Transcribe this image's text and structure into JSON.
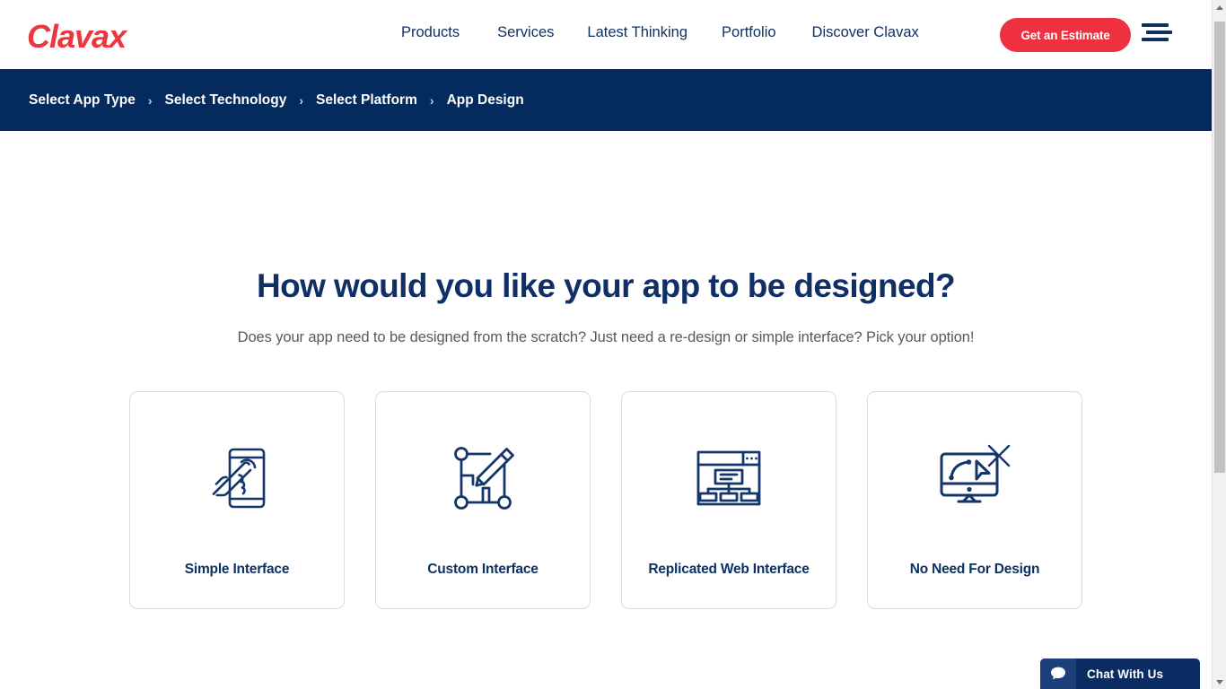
{
  "header": {
    "logo_text": "Clavax",
    "logo_color": "#ec3640",
    "nav_items": [
      {
        "label": "Products"
      },
      {
        "label": "Services"
      },
      {
        "label": "Latest Thinking"
      },
      {
        "label": "Portfolio"
      },
      {
        "label": "Discover Clavax"
      }
    ],
    "cta_label": "Get an Estimate",
    "cta_color": "#ee3040",
    "menu_icon": "hamburger-icon"
  },
  "breadcrumb": {
    "background_color": "#042a5e",
    "separator": "›",
    "items": [
      {
        "label": "Select App Type",
        "current": false
      },
      {
        "label": "Select Technology",
        "current": false
      },
      {
        "label": "Select Platform",
        "current": false
      },
      {
        "label": "App Design",
        "current": true
      }
    ]
  },
  "main": {
    "title": "How would you like your app to be designed?",
    "title_color": "#0f2f66",
    "subtitle": "Does your app need to be designed from the scratch? Just need a re-design or simple interface? Pick your option!",
    "options": [
      {
        "label": "Simple Interface",
        "icon": "phone-tap-icon"
      },
      {
        "label": "Custom Interface",
        "icon": "blueprint-pencil-icon"
      },
      {
        "label": "Replicated Web Interface",
        "icon": "browser-sitemap-icon"
      },
      {
        "label": "No Need For Design",
        "icon": "monitor-cursor-x-icon"
      }
    ]
  },
  "chat_widget": {
    "label": "Chat With Us",
    "icon": "speech-bubble-icon",
    "background_color": "#0a2c63"
  },
  "scrollbar": {
    "up_arrow_icon": "chevron-up-icon",
    "down_arrow_icon": "chevron-down-icon"
  }
}
